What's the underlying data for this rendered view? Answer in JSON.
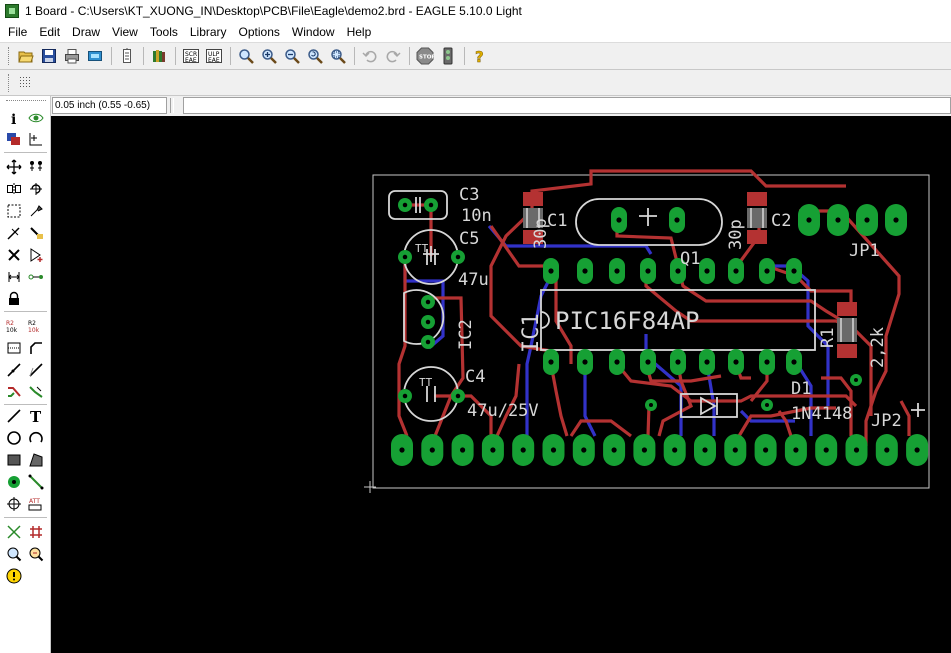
{
  "window": {
    "title": "1 Board - C:\\Users\\KT_XUONG_IN\\Desktop\\PCB\\File\\Eagle\\demo2.brd - EAGLE 5.10.0 Light"
  },
  "menu": [
    {
      "label": "File"
    },
    {
      "label": "Edit"
    },
    {
      "label": "Draw"
    },
    {
      "label": "View"
    },
    {
      "label": "Tools"
    },
    {
      "label": "Library"
    },
    {
      "label": "Options"
    },
    {
      "label": "Window"
    },
    {
      "label": "Help"
    }
  ],
  "toolbar": {
    "icons": [
      "open-icon",
      "save-icon",
      "print-icon",
      "cam-icon",
      "sheet-icon",
      "library-icon",
      "script-icon",
      "ulp-icon",
      "zoom-fit-icon",
      "zoom-in-icon",
      "zoom-out-icon",
      "zoom-redraw-icon",
      "zoom-select-icon",
      "undo-icon",
      "redo-icon",
      "stop-icon",
      "go-icon",
      "help-icon"
    ]
  },
  "coordinates": {
    "readout": "0.05 inch (0.55 -0.65)"
  },
  "command_line": {
    "value": ""
  },
  "colors": {
    "top_copper": "#b43232",
    "bottom_copper": "#3232c8",
    "pads": "#16a034",
    "silkscreen": "#d7d7d7",
    "dimension": "#c8c8c8",
    "background": "#000000"
  },
  "board": {
    "labels": {
      "c3_name": "C3",
      "c3_value": "10n",
      "c5_name": "C5",
      "c5_value": "47u",
      "c1_name": "C1",
      "c1_value": "30p",
      "c2_name": "C2",
      "c2_value": "30p",
      "q1_name": "Q1",
      "jp1_name": "JP1",
      "ic1_name": "IC1",
      "ic1_value": "PIC16F84AP",
      "ic2_name": "IC2",
      "c4_name": "C4",
      "c4_value": "47u/25V",
      "r1_name": "R1",
      "r1_value": "2,2k",
      "d1_name": "D1",
      "d1_value": "1N4148",
      "jp2_name": "JP2",
      "tt1": "TT",
      "tt2": "TT"
    }
  }
}
